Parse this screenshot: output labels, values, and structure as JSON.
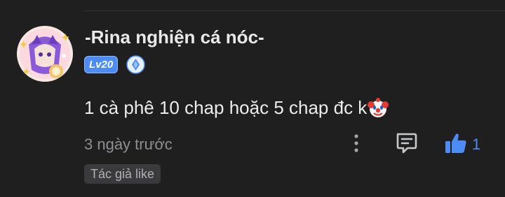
{
  "comment": {
    "username": "-Rina nghiện cá nóc-",
    "level_badge": "Lv20",
    "rank_icon": "blue-diamond-rank-icon",
    "avatar_icon": "anime-girl-avatar",
    "text": "1 cà phê 10 chap hoặc 5 chap đc k",
    "emoji": "clown-face-emoji",
    "timestamp": "3 ngày trước",
    "like_count": "1",
    "author_tag": "Tác giả like"
  },
  "colors": {
    "background": "#1f1f20",
    "accent_blue": "#4d8cf4",
    "text_primary": "#ececec",
    "text_muted": "#8e8f92",
    "tag_bg": "#3a3a3c"
  }
}
